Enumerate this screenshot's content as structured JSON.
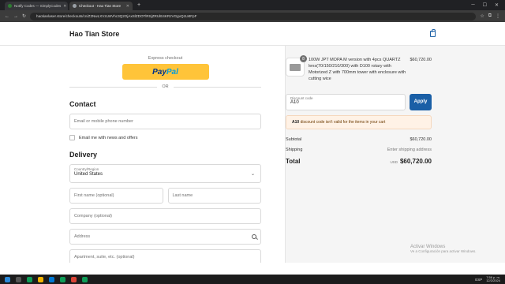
{
  "browser": {
    "tabs": [
      {
        "title": "Notify Codes — SimplyCodes",
        "active": false
      },
      {
        "title": "Checkout - Hao Tian Store",
        "active": true
      }
    ],
    "url": "haotianlaser.store/checkouts/cn/Z2NwLXVzLWVhc3Q2OjAxSlZDOTlRSjZRUlE4KRzVGgvQzLMFpF"
  },
  "store": {
    "name": "Hao Tian Store"
  },
  "express": {
    "label": "Express checkout",
    "paypal_a": "Pay",
    "paypal_b": "Pal",
    "or": "OR"
  },
  "contact": {
    "heading": "Contact",
    "email_placeholder": "Email or mobile phone number",
    "newsletter_label": "Email me with news and offers"
  },
  "delivery": {
    "heading": "Delivery",
    "country_label": "Country/Region",
    "country_value": "United States",
    "first_name_placeholder": "First name (optional)",
    "last_name_placeholder": "Last name",
    "company_placeholder": "Company (optional)",
    "address_placeholder": "Address",
    "apartment_placeholder": "Apartment, suite, etc. (optional)"
  },
  "order": {
    "item_qty": "8",
    "item_description": "100W JPT MOPA M version with 4pcs QUARTZ lens(70/150/210/300) with D100 rotary with Motorized Z with 700mm tower with enclosure with cutting wice",
    "item_price": "$60,720.00",
    "discount_label": "Discount code",
    "discount_value": "A10",
    "apply_label": "Apply",
    "warning_code": "A10",
    "warning_text": " discount code isn't valid for the items in your cart",
    "subtotal_label": "Subtotal",
    "subtotal_value": "$60,720.00",
    "shipping_label": "Shipping",
    "shipping_value": "Enter shipping address",
    "total_label": "Total",
    "total_currency": "USD",
    "total_value": "$60,720.00"
  },
  "windows": {
    "activate_title": "Activar Windows",
    "activate_sub": "Ve a Configuración para activar Windows."
  },
  "taskbar": {
    "lang": "ESP",
    "time": "7:56 p. m.",
    "date": "12/2/2024"
  },
  "colors": {
    "accent": "#1a5fa6",
    "paypal": "#ffc439",
    "warning_bg": "#fff2e6"
  }
}
